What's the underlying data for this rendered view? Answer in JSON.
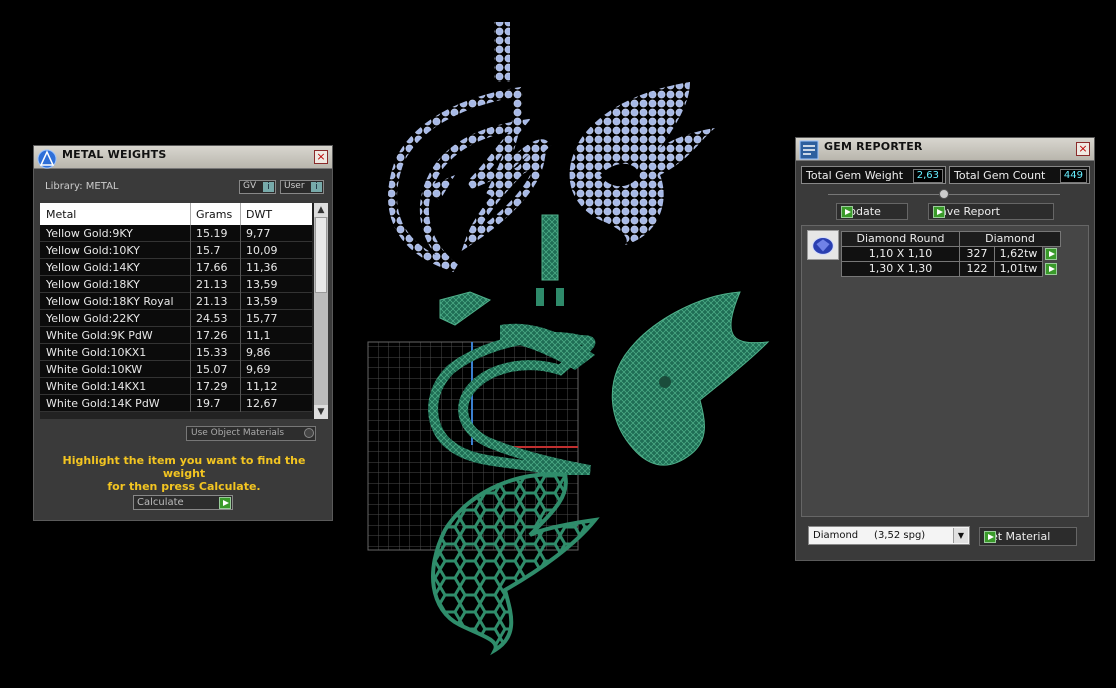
{
  "metal_panel": {
    "title": "METAL WEIGHTS",
    "library_label": "Library: METAL",
    "toggle_gv": "GV",
    "toggle_user": "User",
    "columns": [
      "Metal",
      "Grams",
      "DWT"
    ],
    "rows": [
      [
        "Yellow Gold:9KY",
        "15.19",
        "9,77"
      ],
      [
        "Yellow Gold:10KY",
        "15.7",
        "10,09"
      ],
      [
        "Yellow Gold:14KY",
        "17.66",
        "11,36"
      ],
      [
        "Yellow Gold:18KY",
        "21.13",
        "13,59"
      ],
      [
        "Yellow Gold:18KY Royal",
        "21.13",
        "13,59"
      ],
      [
        "Yellow Gold:22KY",
        "24.53",
        "15,77"
      ],
      [
        "White Gold:9K PdW",
        "17.26",
        "11,1"
      ],
      [
        "White Gold:10KX1",
        "15.33",
        "9,86"
      ],
      [
        "White Gold:10KW",
        "15.07",
        "9,69"
      ],
      [
        "White Gold:14KX1",
        "17.29",
        "11,12"
      ],
      [
        "White Gold:14K PdW",
        "19.7",
        "12,67"
      ]
    ],
    "use_object_materials": "Use Object Materials",
    "hint_line1": "Highlight the item you want to find the weight",
    "hint_line2": "for then press Calculate.",
    "calculate_label": "Calculate"
  },
  "gem_panel": {
    "title": "GEM REPORTER",
    "total_weight_label": "Total Gem Weight",
    "total_weight_value": "2,63",
    "total_count_label": "Total Gem Count",
    "total_count_value": "449",
    "update_label": "Update",
    "save_report_label": "Save Report",
    "table_headers": [
      "Diamond Round",
      "Diamond"
    ],
    "table_rows": [
      [
        "1,10 X 1,10",
        "327",
        "1,62tw"
      ],
      [
        "1,30 X 1,30",
        "122",
        "1,01tw"
      ]
    ],
    "material_select": "Diamond     (3,52 spg)",
    "set_material_label": "Set Material"
  },
  "colors": {
    "gem_dots": "#a7b9e6",
    "mesh_green": "#2e8a6a",
    "hint_yellow": "#f3c521",
    "stat_value": "#66eeff"
  }
}
